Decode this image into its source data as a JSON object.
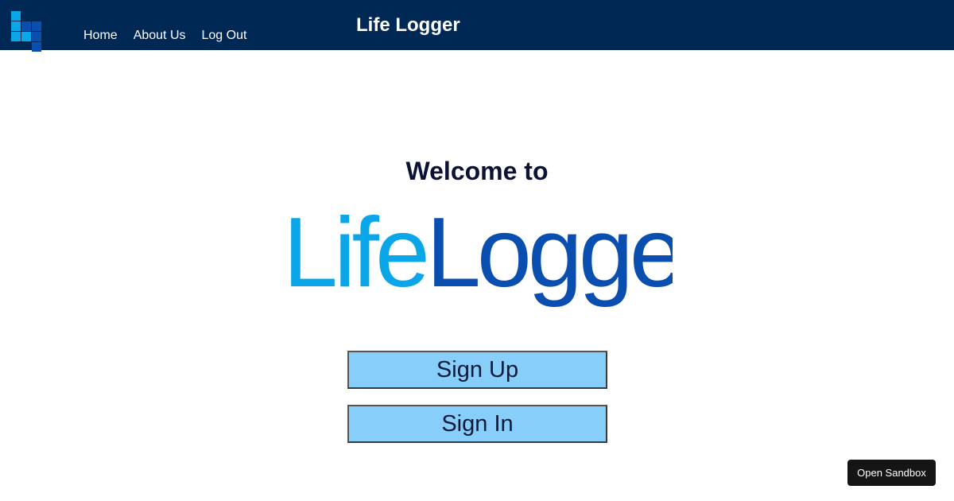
{
  "header": {
    "app_title": "Life Logger",
    "logo_icon": "lifelogger-blocks-logo",
    "nav": [
      {
        "label": "Home"
      },
      {
        "label": "About Us"
      },
      {
        "label": "Log Out"
      }
    ]
  },
  "main": {
    "welcome_text": "Welcome to",
    "wordmark": {
      "part1": "Life",
      "part2": "Logger",
      "part1_color": "#0aa6e8",
      "part2_color": "#0a4fb0"
    },
    "sign_up_label": "Sign Up",
    "sign_in_label": "Sign In"
  },
  "sandbox": {
    "label": "Open Sandbox"
  },
  "colors": {
    "header_bg": "#002855",
    "button_bg": "#87cefa",
    "logo_light": "#0aa6e8",
    "logo_dark": "#0a4fb0"
  }
}
